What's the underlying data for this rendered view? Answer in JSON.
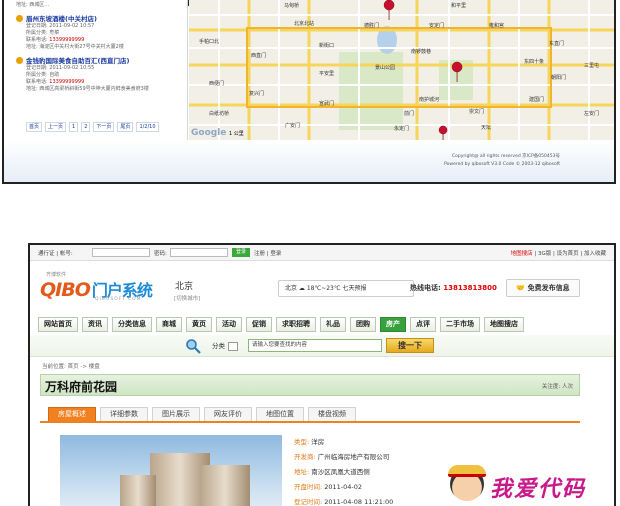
{
  "screenshot_top": {
    "listings": [
      {
        "top_line": "地址: 西城区..."
      },
      {
        "name": "眉州东坡酒楼(中关村店)",
        "registered": "登记日期: 2011-09-02 10:57",
        "category": "所属分类: 粤菜",
        "phone_label": "联系电话: ",
        "phone": "13399999999",
        "address": "地址: 海淀区中关村大街27号中关村大厦2楼"
      },
      {
        "name": "金钱豹国际美食自助百汇(西直门店)",
        "registered": "登记日期: 2011-09-02 10:55",
        "category": "所属分类: 自助",
        "phone_label": "联系电话: ",
        "phone": "13399999999",
        "address": "地址: 西城区高梁桥斜街59号中坤大厦内鲜食美食府3楼"
      }
    ],
    "pager": [
      "首页",
      "上一页",
      "1",
      "2",
      "下一页",
      "尾页",
      "1/2/10"
    ],
    "map_labels": [
      "马甸桥",
      "手帕口北",
      "德胜门",
      "白纸坊桥",
      "复兴门",
      "西直门",
      "新街口",
      "安定门",
      "雍和宫",
      "北京北站",
      "南锣鼓巷",
      "东直门",
      "东四十条",
      "三里屯",
      "朝阳门",
      "建国门",
      "崇文门",
      "前门",
      "天坛",
      "左安门",
      "景山公园",
      "南护城河",
      "永定门",
      "西便门",
      "广安门",
      "和平里",
      "平安里",
      "宣武门"
    ],
    "map_brand": "Google",
    "scale_label": "1 公里",
    "copyright": "Copyright@ all rights reserved 京ICP备050453号",
    "powered": "Powered by qibosoft V3.0 Code © 2003-12 qibosoft"
  },
  "screenshot_bottom": {
    "topbar": {
      "account_label": "通行证 | 帐号:",
      "password_label": "密码:",
      "login_btn": "登录",
      "register": "注册 | 登录",
      "right_links_red": "地图搜店",
      "right_links": " | 3G版 | 设为首页 | 加入收藏"
    },
    "logo": {
      "prefix": "QIBO",
      "text": "门户系统",
      "top": "齐博软件",
      "sub": "QIBOSOFT.COM"
    },
    "city": "北京",
    "city_switch": "[切换城市]",
    "weather": "北京 ☁ 18℃~23℃ 七天预报",
    "hotline_label": "热线电话: ",
    "hotline": "13813813800",
    "free_publish": "免费发布信息",
    "nav": [
      "网站首页",
      "资讯",
      "分类信息",
      "商城",
      "黄页",
      "活动",
      "促销",
      "求职招聘",
      "礼品",
      "团购",
      "房产",
      "点评",
      "二手市场",
      "地图搜店"
    ],
    "nav_active": "房产",
    "search": {
      "category": "分类",
      "placeholder": "请输入您要查找的内容",
      "button": "搜一下"
    },
    "breadcrumb": "当前位置: 首页 -> 楼盘",
    "page_title": "万科府前花园",
    "attention": "关注度: 人次",
    "tabs": [
      "房屋概述",
      "详细参数",
      "图片展示",
      "网友评价",
      "地图位置",
      "楼盘视频"
    ],
    "active_tab": "房屋概述",
    "info": [
      {
        "k": "类型: ",
        "v": "洋房"
      },
      {
        "k": "开发商: ",
        "v": "广州临海房地产有限公司"
      },
      {
        "k": "地址: ",
        "v": "南沙区凤凰大道西侧"
      },
      {
        "k": "开盘时间: ",
        "v": "2011-04-02"
      },
      {
        "k": "登记时间: ",
        "v": "2011-04-08 11:21:00"
      }
    ],
    "watermark": "我爱代码"
  },
  "colors": {
    "accent_green": "#38a03c",
    "orange": "#f08020",
    "link_blue": "#1a3b9e",
    "red": "#d00000"
  }
}
